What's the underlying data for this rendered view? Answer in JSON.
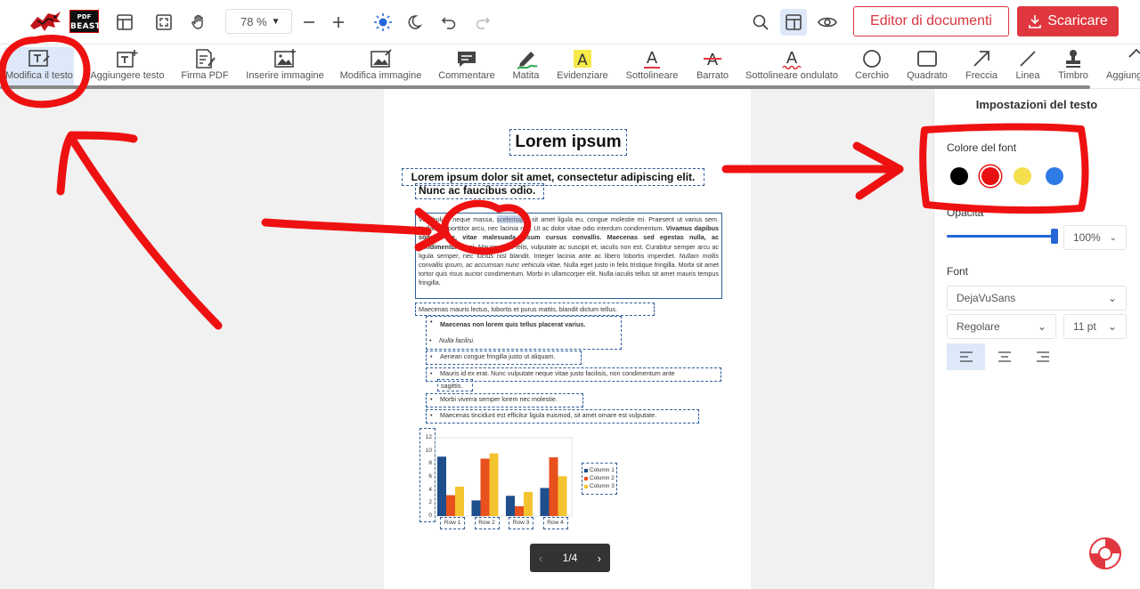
{
  "logo": {
    "brand_line1": "PDF",
    "brand_line2": "BEAST"
  },
  "topbar": {
    "zoom": "78 %",
    "editor_button": "Editor di documenti",
    "download_button": "Scaricare"
  },
  "tools": [
    {
      "label": "Modifica il testo",
      "icon": "edit-text-icon"
    },
    {
      "label": "Aggiungere testo",
      "icon": "add-text-icon"
    },
    {
      "label": "Firma PDF",
      "icon": "signature-icon"
    },
    {
      "label": "Inserire immagine",
      "icon": "insert-image-icon"
    },
    {
      "label": "Modifica immagine",
      "icon": "edit-image-icon"
    },
    {
      "label": "Commentare",
      "icon": "comment-icon"
    },
    {
      "label": "Matita",
      "icon": "pencil-icon"
    },
    {
      "label": "Evidenziare",
      "icon": "highlight-icon"
    },
    {
      "label": "Sottolineare",
      "icon": "underline-icon"
    },
    {
      "label": "Barrato",
      "icon": "strikethrough-icon"
    },
    {
      "label": "Sottolineare ondulato",
      "icon": "wavy-underline-icon"
    },
    {
      "label": "Cerchio",
      "icon": "circle-icon"
    },
    {
      "label": "Quadrato",
      "icon": "square-icon"
    },
    {
      "label": "Freccia",
      "icon": "arrow-icon"
    },
    {
      "label": "Linea",
      "icon": "line-icon"
    },
    {
      "label": "Timbro",
      "icon": "stamp-icon"
    },
    {
      "label": "Aggiung",
      "icon": "add-more-icon"
    }
  ],
  "document": {
    "title": "Lorem ipsum",
    "subtitle": "Lorem ipsum dolor sit amet, consectetur adipiscing elit.",
    "subtitle2": "Nunc ac faucibus odio.",
    "paragraph": {
      "before_highlight": "Vestibulum neque massa, ",
      "highlight": "scelerisque",
      "after_highlight": " sit amet ligula eu, congue molestie mi. Praesent ut varius sem. Nullam at porttitor arcu, nec lacinia nisi. Ut ac dolor vitae odio interdum condimentum. ",
      "bold_part": "Vivamus dapibus sodales ex, vitae malesuada ipsum cursus convallis. Maecenas sed egestas nulla, ac condimentum orci.",
      "middle": " Mauris diam felis, vulputate ac suscipit et, iaculis non est. Curabitur semper arcu ac ligula semper, nec luctus nisl blandit. Integer lacinia ante ac libero lobortis imperdiet. ",
      "italic_part": "Nullam mollis convallis ipsum, ac accumsan nunc vehicula vitae.",
      "end": " Nulla eget justo in felis tristique fringilla. Morbi sit amet tortor quis risus auctor condimentum. Morbi in ullamcorper elit. Nulla iaculis tellus sit amet mauris tempus fringilla."
    },
    "line_after_para": "Maecenas mauris lectus, lobortis et purus mattis, blandit dictum tellus.",
    "bullets": [
      "Maecenas non lorem quis tellus placerat varius.",
      "Nulla facilisi.",
      "Aenean congue fringilla justo ut aliquam.",
      "Mauris id ex erat. Nunc vulputate neque vitae justo facilisis, non condimentum ante",
      "sagittis.",
      "Morbi viverra semper lorem nec molestie.",
      "Maecenas tincidunt est efficitur ligula euismod, sit amet ornare est vulputate."
    ]
  },
  "chart_data": {
    "type": "bar",
    "categories": [
      "Row 1",
      "Row 2",
      "Row 3",
      "Row 4"
    ],
    "series": [
      {
        "name": "Column 1",
        "color": "#1f4e8c",
        "values": [
          9.1,
          2.4,
          3.1,
          4.3
        ]
      },
      {
        "name": "Column 2",
        "color": "#e8501e",
        "values": [
          3.2,
          8.8,
          1.5,
          9.0
        ]
      },
      {
        "name": "Column 3",
        "color": "#f4c430",
        "values": [
          4.5,
          9.6,
          3.7,
          6.1
        ]
      }
    ],
    "yticks": [
      "12",
      "10",
      "8",
      "6",
      "4",
      "2",
      "0"
    ],
    "ylim": [
      0,
      12
    ],
    "legend": "right"
  },
  "pager": {
    "text": "1/4"
  },
  "panel": {
    "title": "Impostazioni del testo",
    "font_color_label": "Colore del font",
    "colors": [
      "#000000",
      "#e81010",
      "#f4e04d",
      "#2f7be5"
    ],
    "opacity_label": "Opacità",
    "opacity_value": "100%",
    "opacity_fraction": 1.0,
    "font_label": "Font",
    "font_family": "DejaVuSans",
    "font_style": "Regolare",
    "font_size": "11 pt"
  },
  "annotation_color": "#ee1111"
}
